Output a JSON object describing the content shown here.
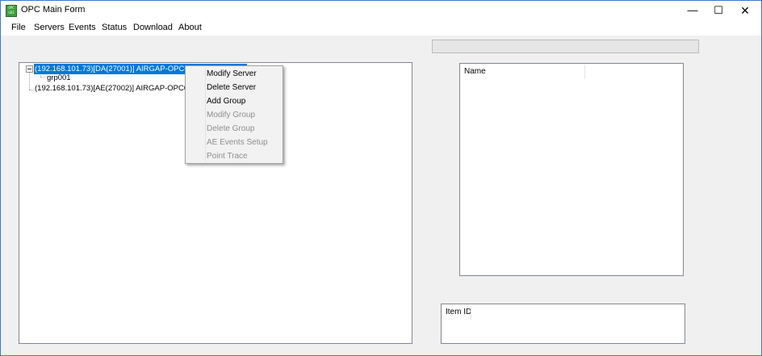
{
  "window": {
    "title": "OPC Main Form",
    "icon_text": "OPC GUI",
    "controls": {
      "minimize": "—",
      "maximize": "☐",
      "close": "✕"
    }
  },
  "menubar": {
    "items": [
      "File",
      "Servers",
      "Events",
      "Status",
      "Download",
      "About"
    ]
  },
  "progress": {
    "value": 0
  },
  "tree": {
    "nodes": [
      {
        "label": "(192.168.101.73)[DA(27001)] AIRGAP-OPC02.Matrikon.OPC.Simulation.1",
        "selected": true
      },
      {
        "label": "grp001"
      },
      {
        "label": "(192.168.101.73)[AE(27002)] AIRGAP-OPC02.Matrikon.OPC.Simulation.1"
      }
    ]
  },
  "context_menu": {
    "items": [
      {
        "label": "Modify Server",
        "enabled": true
      },
      {
        "label": "Delete Server",
        "enabled": true
      },
      {
        "label": "Add Group",
        "enabled": true
      },
      {
        "label": "Modify Group",
        "enabled": false
      },
      {
        "label": "Delete Group",
        "enabled": false
      },
      {
        "label": "AE Events Setup",
        "enabled": false
      },
      {
        "label": "Point Trace",
        "enabled": false
      }
    ]
  },
  "list_view": {
    "columns": [
      "Name"
    ]
  },
  "item_view": {
    "columns": [
      "Item ID"
    ]
  },
  "colors": {
    "selection": "#0078d7",
    "disabled_text": "#8d8d8d",
    "window_border": "#3c78c8"
  }
}
